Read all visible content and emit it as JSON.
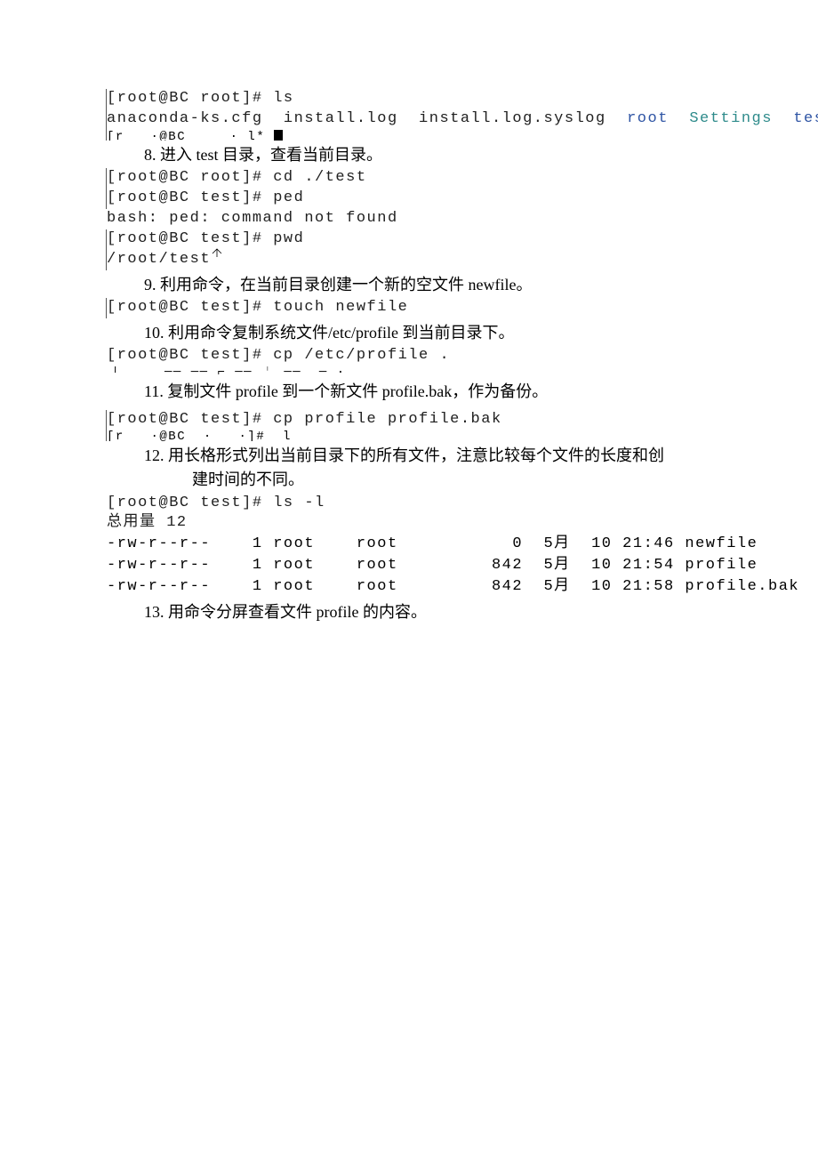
{
  "block1": {
    "line1": "[root@BC root]# ls",
    "line2_pre": "anaconda-ks.cfg  install.log  install.log.syslog  ",
    "line2_root": "root",
    "line2_sp1": "  ",
    "line2_settings": "Settings",
    "line2_sp2": "  ",
    "line2_test": "test",
    "frag": "[r   ·@BC     · l*"
  },
  "step8": {
    "text": "8.   进入 test 目录，查看当前目录。",
    "t1": "[root@BC root]# cd ./test",
    "t2": "[root@BC test]# ped",
    "t3": "bash: ped: command not found",
    "t4": "[root@BC test]# pwd",
    "t5": "/root/test"
  },
  "step9": {
    "text": "9.   利用命令，在当前目录创建一个新的空文件 newfile。",
    "t1": "[root@BC test]# touch newfile"
  },
  "step10": {
    "text": "10.   利用命令复制系统文件/etc/profile 到当前目录下。",
    "t1": "[root@BC test]# cp /etc/profile .",
    "frag": "「     ── ── ⌐ ── ╵ ──  ─ ·"
  },
  "step11": {
    "text": "11.   复制文件 profile 到一个新文件 profile.bak，作为备份。",
    "t1": "[root@BC test]# cp profile profile.bak",
    "frag": "[r   ·@BC  ·   ·]#  l"
  },
  "step12": {
    "text": "12.  用长格形式列出当前目录下的所有文件，注意比较每个文件的长度和创",
    "text_cont": "建时间的不同。",
    "t1": "[root@BC test]# ls -l",
    "t2": "总用量 12",
    "rows": [
      {
        "perm": "-rw-r--r--",
        "links": "1",
        "owner": "root",
        "group": "root",
        "size": "0",
        "month": "5月",
        "day": "10",
        "time": "21:46",
        "name": "newfile"
      },
      {
        "perm": "-rw-r--r--",
        "links": "1",
        "owner": "root",
        "group": "root",
        "size": "842",
        "month": "5月",
        "day": "10",
        "time": "21:54",
        "name": "profile"
      },
      {
        "perm": "-rw-r--r--",
        "links": "1",
        "owner": "root",
        "group": "root",
        "size": "842",
        "month": "5月",
        "day": "10",
        "time": "21:58",
        "name": "profile.bak"
      }
    ]
  },
  "step13": {
    "text": "13.  用命令分屏查看文件 profile 的内容。"
  }
}
